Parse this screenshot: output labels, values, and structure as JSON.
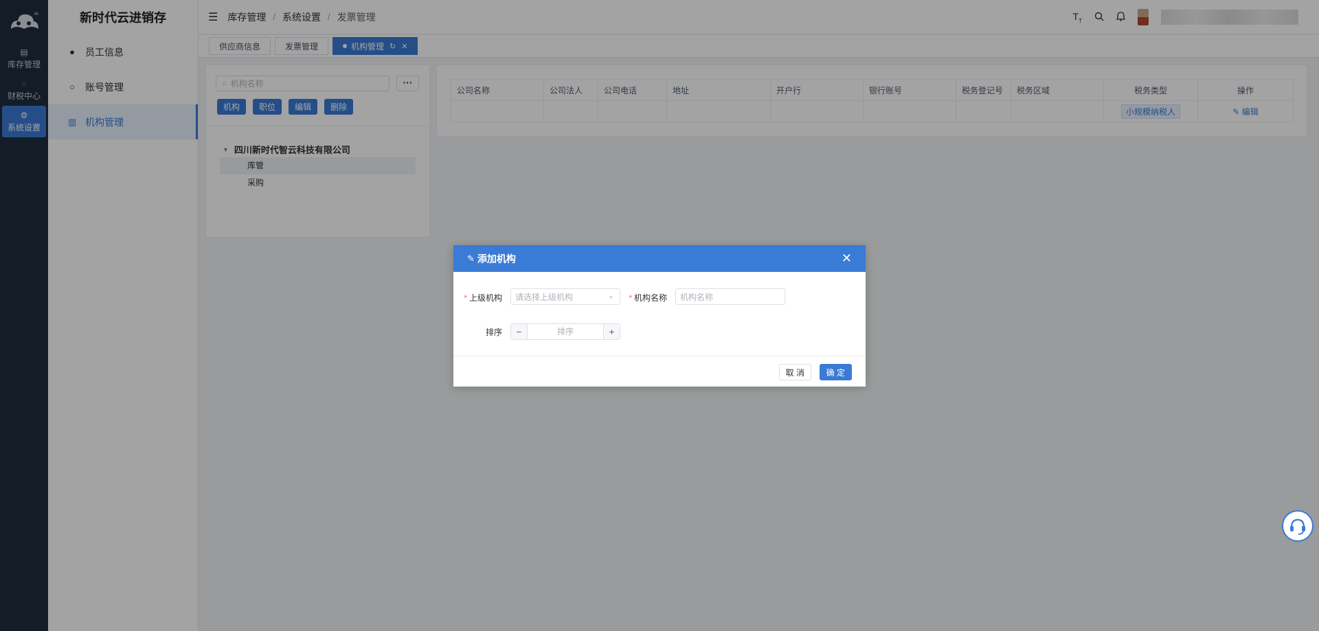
{
  "app": {
    "title": "新时代云进销存"
  },
  "rail": {
    "items": [
      {
        "label": "库存管理",
        "icon": "warehouse-icon",
        "glyph": "▤"
      },
      {
        "label": "财税中心",
        "icon": "finance-icon",
        "glyph": "◌"
      },
      {
        "label": "系统设置",
        "icon": "settings-icon",
        "glyph": "⚙"
      }
    ]
  },
  "submenu": {
    "items": [
      {
        "label": "员工信息",
        "icon": "user-filled-icon",
        "glyph": "●"
      },
      {
        "label": "账号管理",
        "icon": "user-outline-icon",
        "glyph": "○"
      },
      {
        "label": "机构管理",
        "icon": "building-icon",
        "glyph": "▥"
      }
    ]
  },
  "header": {
    "breadcrumb": [
      "库存管理",
      "系统设置",
      "发票管理"
    ]
  },
  "tabs": [
    {
      "label": "供应商信息"
    },
    {
      "label": "发票管理"
    },
    {
      "label": "机构管理"
    }
  ],
  "org_panel": {
    "search_placeholder": "机构名称",
    "more_label": "···",
    "buttons": [
      "机构",
      "职位",
      "编辑",
      "删除"
    ],
    "tree": {
      "root": "四川新时代智云科技有限公司",
      "children": [
        "库管",
        "采购"
      ]
    }
  },
  "table": {
    "columns": [
      "公司名称",
      "公司法人",
      "公司电话",
      "地址",
      "开户行",
      "银行账号",
      "税务登记号",
      "税务区域",
      "税务类型",
      "操作"
    ],
    "rows": [
      {
        "tax_type": "小规模纳税人",
        "action": "编辑"
      }
    ]
  },
  "dialog": {
    "title": "添加机构",
    "parent_label": "上级机构",
    "parent_placeholder": "请选择上级机构",
    "name_label": "机构名称",
    "name_placeholder": "机构名称",
    "sort_label": "排序",
    "sort_placeholder": "排序",
    "cancel": "取 消",
    "confirm": "确 定"
  },
  "colors": {
    "primary": "#3a7bd5",
    "rail_bg": "#1f2d3d",
    "required": "#f56c6c"
  }
}
